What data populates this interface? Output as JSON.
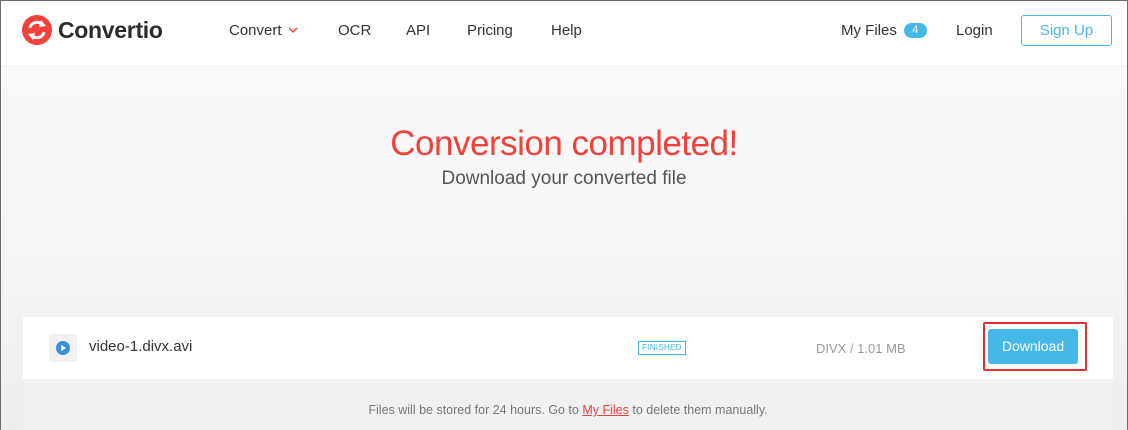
{
  "app": {
    "name": "Convertio"
  },
  "nav": {
    "items": [
      {
        "label": "Convert",
        "has_dropdown": true
      },
      {
        "label": "OCR"
      },
      {
        "label": "API"
      },
      {
        "label": "Pricing"
      },
      {
        "label": "Help"
      }
    ],
    "my_files_label": "My Files",
    "my_files_count": "4",
    "login_label": "Login",
    "signup_label": "Sign Up"
  },
  "hero": {
    "title": "Conversion completed!",
    "subtitle": "Download your converted file"
  },
  "file": {
    "icon": "play-icon",
    "name": "video-1.divx.avi",
    "status": "FINISHED",
    "meta": "DIVX / 1.01 MB",
    "download_label": "Download"
  },
  "note": {
    "before": "Files will be stored for 24 hours. Go to ",
    "link": "My Files",
    "after": " to delete them manually."
  },
  "colors": {
    "brand_red": "#f2403a",
    "accent_blue": "#45b8e8",
    "highlight_red": "#e03030"
  }
}
